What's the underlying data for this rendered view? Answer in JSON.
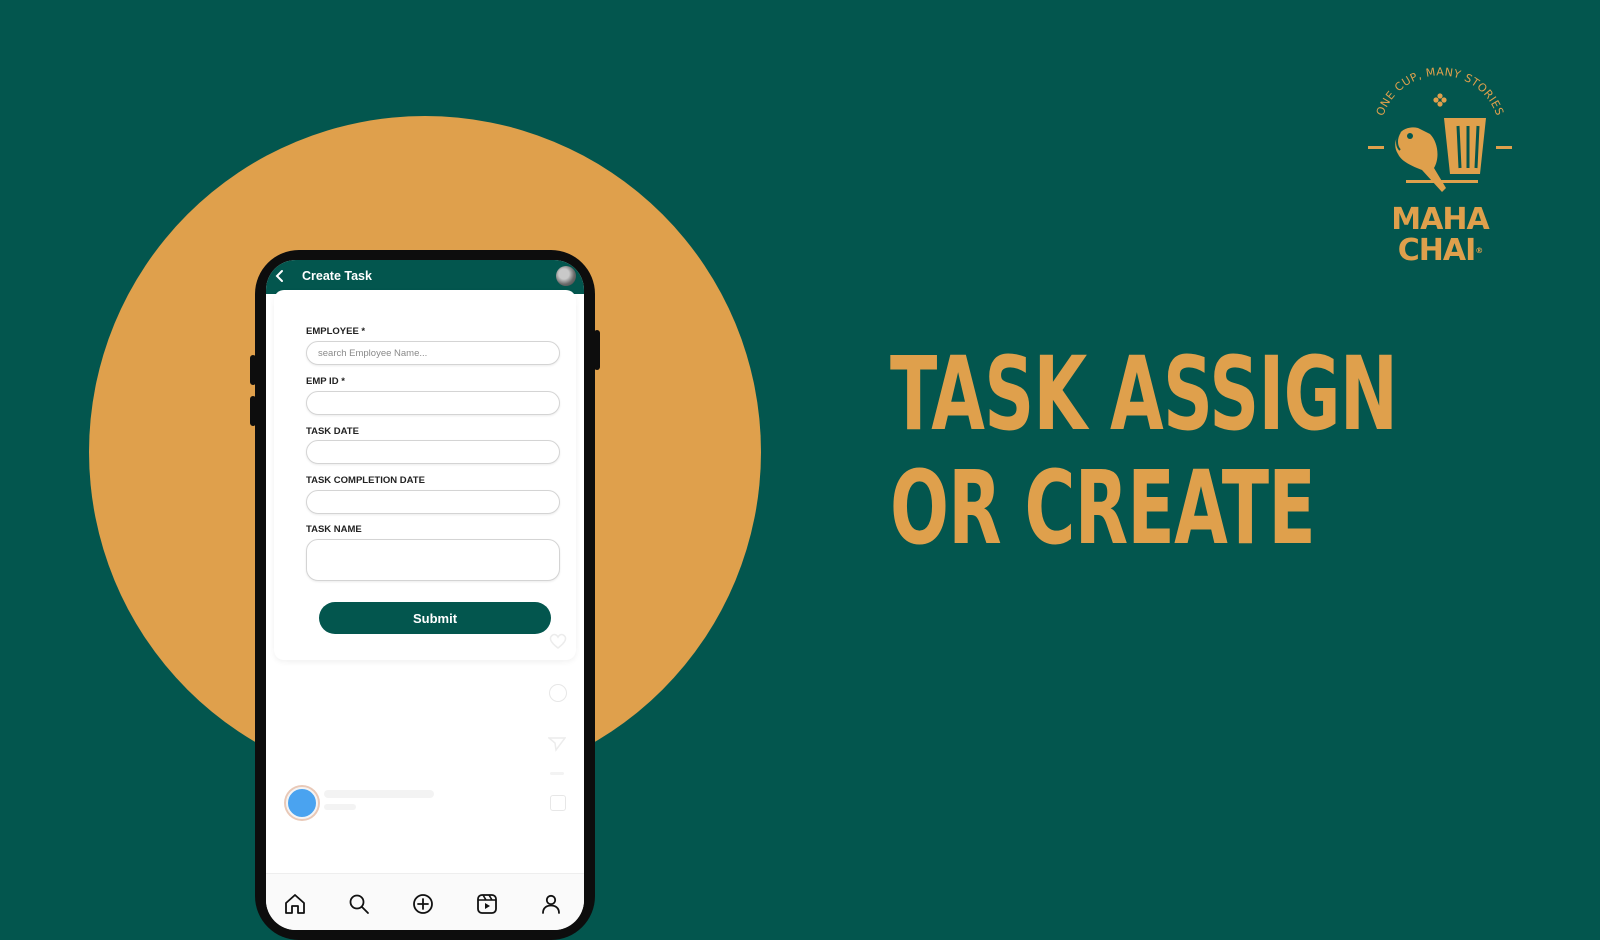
{
  "colors": {
    "background": "#03564e",
    "accent": "#dfa04c",
    "app_primary": "#03564e",
    "story_dot": "#4aa3f0"
  },
  "headline": {
    "line1": "TASK ASSIGN",
    "line2": "OR CREATE"
  },
  "logo": {
    "tagline": "ONE CUP, MANY STORIES",
    "line1": "MAHA",
    "line2": "CHAI",
    "mark": "®"
  },
  "app": {
    "title": "Create Task",
    "form": {
      "employee_label": "EMPLOYEE *",
      "employee_placeholder": "search Employee Name...",
      "emp_id_label": "EMP ID *",
      "task_date_label": "TASK DATE",
      "task_completion_label": "TASK COMPLETION DATE",
      "task_name_label": "TASK NAME",
      "submit_label": "Submit"
    },
    "bottom_nav": [
      "home-icon",
      "search-icon",
      "add-icon",
      "reels-icon",
      "profile-icon"
    ]
  }
}
